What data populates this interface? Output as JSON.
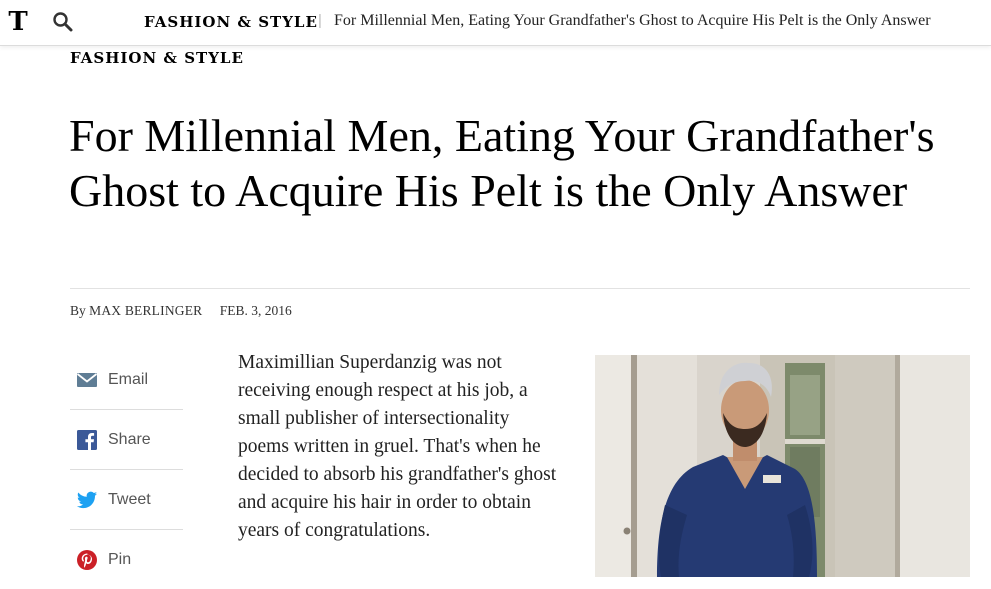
{
  "topbar": {
    "logo": "T",
    "section": "FASHION & STYLE",
    "separator": "|",
    "headline": "For Millennial Men, Eating Your Grandfather's Ghost to Acquire His Pelt is the Only Answer"
  },
  "article": {
    "kicker": "FASHION & STYLE",
    "headline": "For Millennial Men, Eating Your Grandfather's Ghost to Acquire His Pelt is the Only Answer",
    "byline_prefix": "By",
    "author": "MAX BERLINGER",
    "date": "FEB. 3, 2016",
    "body": "Maximillian Superdanzig was not receiving enough respect at his job, a small publisher of intersectionality poems written in gruel. That's when he decided to absorb his grandfather's ghost and acquire his hair in order to obtain years of congratulations."
  },
  "share": {
    "items": [
      {
        "label": "Email",
        "icon": "email-icon",
        "color": "#5f7d95"
      },
      {
        "label": "Share",
        "icon": "facebook-icon",
        "color": "#3b5998"
      },
      {
        "label": "Tweet",
        "icon": "twitter-icon",
        "color": "#1da1f2"
      },
      {
        "label": "Pin",
        "icon": "pinterest-icon",
        "color": "#cb2027"
      }
    ]
  }
}
